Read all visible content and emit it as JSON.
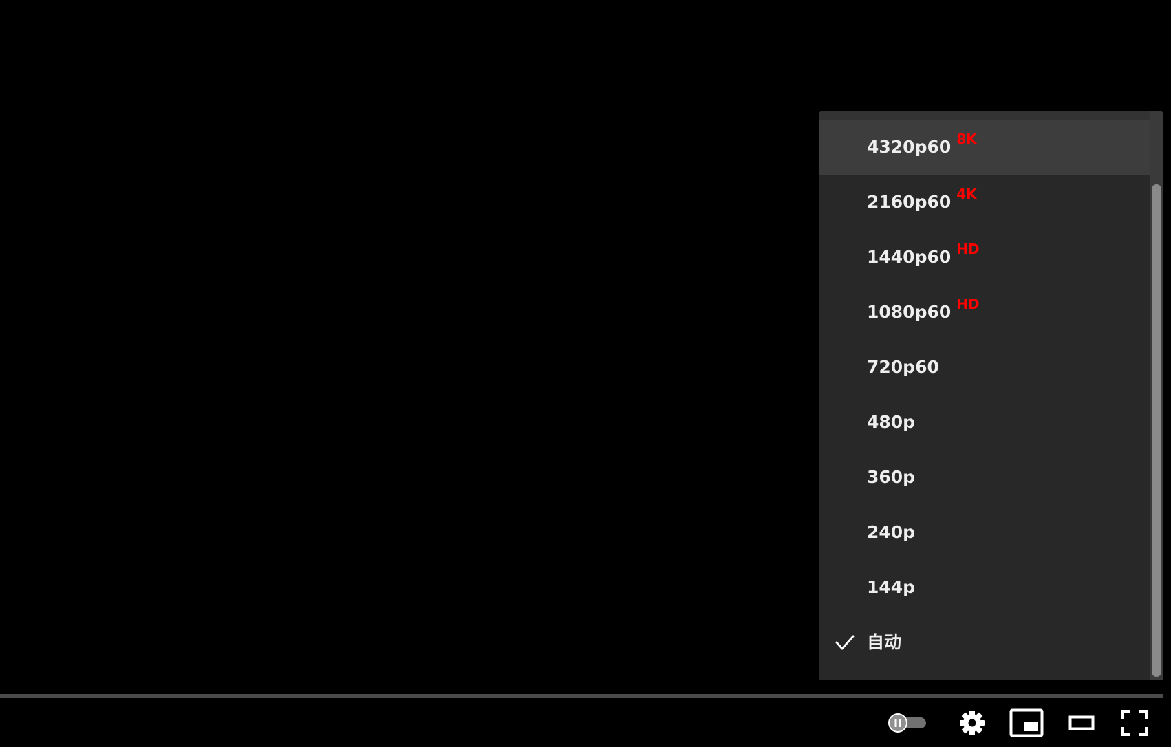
{
  "quality_menu": {
    "items": [
      {
        "label": "4320p60",
        "badge": "8K",
        "selected": false
      },
      {
        "label": "2160p60",
        "badge": "4K",
        "selected": false
      },
      {
        "label": "1440p60",
        "badge": "HD",
        "selected": false
      },
      {
        "label": "1080p60",
        "badge": "HD",
        "selected": false
      },
      {
        "label": "720p60",
        "badge": "",
        "selected": false
      },
      {
        "label": "480p",
        "badge": "",
        "selected": false
      },
      {
        "label": "360p",
        "badge": "",
        "selected": false
      },
      {
        "label": "240p",
        "badge": "",
        "selected": false
      },
      {
        "label": "144p",
        "badge": "",
        "selected": false
      },
      {
        "label": "自动",
        "badge": "",
        "selected": true
      }
    ],
    "hovered_index": 0
  },
  "controls": {
    "autoplay": {
      "state": "off",
      "icon": "pause-icon"
    },
    "settings": {
      "icon": "gear-icon"
    },
    "miniplayer": {
      "icon": "miniplayer-icon"
    },
    "theater": {
      "icon": "theater-mode-icon"
    },
    "fullscreen": {
      "icon": "fullscreen-icon"
    }
  },
  "colors": {
    "background": "#000000",
    "menu_bg": "#282828",
    "menu_hover": "#3d3d3d",
    "text": "#eeeeee",
    "badge": "#ff0000",
    "icon": "#ffffff"
  }
}
